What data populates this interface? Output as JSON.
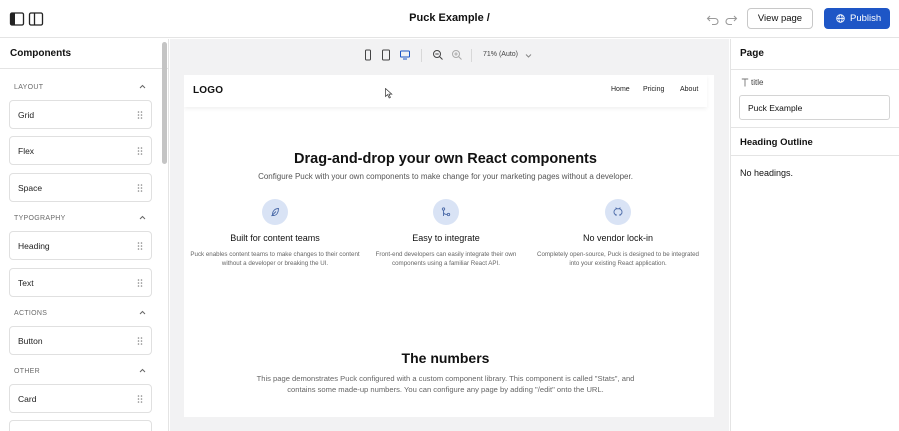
{
  "header": {
    "title": "Puck Example /",
    "view_page_label": "View page",
    "publish_label": "Publish"
  },
  "left_sidebar": {
    "title": "Components",
    "categories": [
      {
        "label": "LAYOUT",
        "items": [
          "Grid",
          "Flex",
          "Space"
        ]
      },
      {
        "label": "TYPOGRAPHY",
        "items": [
          "Heading",
          "Text"
        ]
      },
      {
        "label": "ACTIONS",
        "items": [
          "Button"
        ]
      },
      {
        "label": "OTHER",
        "items": [
          "Card"
        ]
      }
    ]
  },
  "canvas": {
    "zoom": "71% (Auto)",
    "site": {
      "logo": "LOGO",
      "nav": [
        "Home",
        "Pricing",
        "About"
      ],
      "hero_title": "Drag-and-drop your own React components",
      "hero_subtitle": "Configure Puck with your own components to make change for your marketing pages without a developer.",
      "features": [
        {
          "title": "Built for content teams",
          "desc": "Puck enables content teams to make changes to their content without a developer or breaking the UI.",
          "icon": "feather-icon"
        },
        {
          "title": "Easy to integrate",
          "desc": "Front-end developers can easily integrate their own components using a familiar React API.",
          "icon": "git-merge-icon"
        },
        {
          "title": "No vendor lock-in",
          "desc": "Completely open-source, Puck is designed to be integrated into your existing React application.",
          "icon": "github-icon"
        }
      ],
      "numbers_title": "The numbers",
      "numbers_text": "This page demonstrates Puck configured with a custom component library. This component is called \"Stats\", and contains some made-up numbers. You can configure any page by adding \"/edit\" onto the URL."
    }
  },
  "right_panel": {
    "title": "Page",
    "field_label": "title",
    "field_value": "Puck Example",
    "outline_title": "Heading Outline",
    "outline_empty": "No headings."
  },
  "colors": {
    "accent": "#1e56c6",
    "icon_bg": "#d9e3f5",
    "icon_fg": "#4b6aa8"
  }
}
